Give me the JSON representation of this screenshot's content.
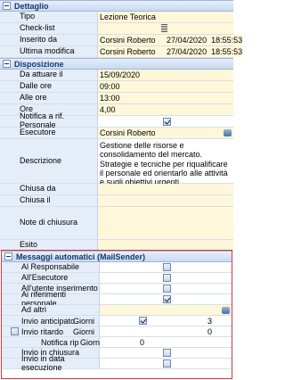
{
  "sections": {
    "dettaglio": "Dettaglio",
    "disposizione": "Disposizione",
    "messaggi": "Messaggi automatici (MailSender)"
  },
  "dettaglio": {
    "tipo_label": "Tipo",
    "tipo_value": "Lezione Teorica",
    "checklist_label": "Check-list",
    "inserito_label": "Inserito da",
    "inserito_value": "Corsini Roberto     27/04/2020  18:55:53",
    "modifica_label": "Ultima modifica",
    "modifica_value": "Corsini Roberto     27/04/2020  18:55:53"
  },
  "disposizione": {
    "data_label": "Da attuare il",
    "data_value": "15/09/2020",
    "dalle_label": "Dalle ore",
    "dalle_value": "09:00",
    "alle_label": "Alle ore",
    "alle_value": "13:00",
    "ore_label": "Ore",
    "ore_value": "4,00",
    "notifica_label": "Notifica a rif. Personale",
    "esecutore_label": "Esecutore",
    "esecutore_value": "Corsini Roberto",
    "descrizione_label": "Descrizione",
    "descrizione_value": "Gestione delle risorse e consolidamento del mercato.\nStrategie e tecniche per riqualificare il personale ed orientarlo alle attività e sugli obiettivi urgenti.",
    "chiusa_da_label": "Chiusa da",
    "chiusa_il_label": "Chiusa il",
    "note_label": "Note di chiusura",
    "esito_label": "Esito"
  },
  "messaggi": {
    "responsabile_label": "Al Responsabile",
    "esecutore_label": "All'Esecutore",
    "utente_label": "All'utente inserimento",
    "riferimenti_label": "Ai riferimenti personale",
    "altri_label": "Ad altri",
    "anticipato_label": "Invio anticipato",
    "anticipato_giorni": "Giorni",
    "anticipato_value": "3",
    "ritardo_label": "Invio ritardo",
    "ritardo_giorni": "Giorni",
    "ritardo_value": "0",
    "notifica_rip_label": "Notifica rip",
    "notifica_rip_giorni": "Giorni",
    "notifica_rip_value": "0",
    "chiusura_label": "Invio in chiusura",
    "data_esecuzione_label": "Invio in data esecuzione"
  }
}
